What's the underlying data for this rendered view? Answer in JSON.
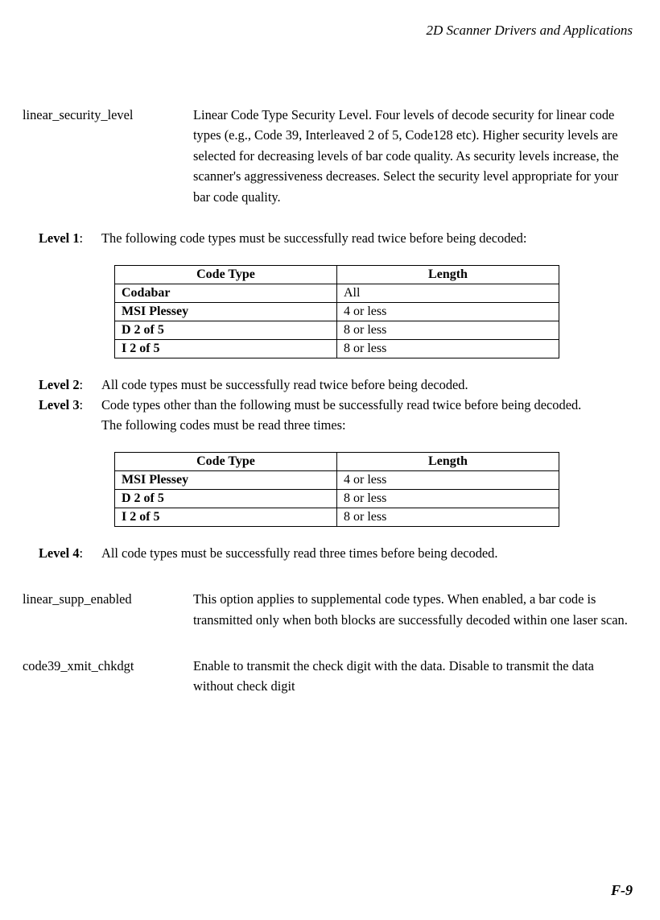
{
  "header": {
    "title": "2D Scanner Drivers and Applications"
  },
  "params": {
    "linear_security_level": {
      "name": "linear_security_level",
      "desc": "Linear Code Type Security Level.  Four levels of decode security for linear code types (e.g., Code 39, Interleaved 2 of 5, Code128 etc). Higher security levels are selected for decreasing levels of bar code quality. As security levels increase, the scanner's aggressiveness decreases. Select the security level appropriate for your bar code quality."
    },
    "linear_supp_enabled": {
      "name": "linear_supp_enabled",
      "desc": "This option applies to supplemental code types. When enabled, a bar code is transmitted only when both blocks are successfully decoded within one laser scan."
    },
    "code39_xmit_chkdgt": {
      "name": "code39_xmit_chkdgt",
      "desc": "Enable to transmit the check digit with the data.  Disable to transmit the data without check digit"
    }
  },
  "levels": {
    "l1": {
      "label": "Level 1",
      "desc": "The following code types must be successfully read twice before being decoded:"
    },
    "l2": {
      "label": "Level 2",
      "desc": "All code types must be successfully read twice before being decoded."
    },
    "l3": {
      "label": "Level 3",
      "desc1": "Code types other than the following must be successfully read twice before being decoded.",
      "desc2": "The following codes must be read three times:"
    },
    "l4": {
      "label": "Level 4",
      "desc": "All code types must be successfully read three times before being decoded."
    }
  },
  "table_headers": {
    "ctype": "Code Type",
    "length": "Length"
  },
  "table1": {
    "r0": {
      "t": "Codabar",
      "l": "All"
    },
    "r1": {
      "t": "MSI Plessey",
      "l": "4 or less"
    },
    "r2": {
      "t": "D 2 of 5",
      "l": "8 or less"
    },
    "r3": {
      "t": "I 2 of 5",
      "l": "8 or less"
    }
  },
  "table2": {
    "r0": {
      "t": "MSI Plessey",
      "l": "4 or less"
    },
    "r1": {
      "t": "D 2 of 5",
      "l": "8 or less"
    },
    "r2": {
      "t": "I 2 of 5",
      "l": "8 or less"
    }
  },
  "page_number": "F-9"
}
